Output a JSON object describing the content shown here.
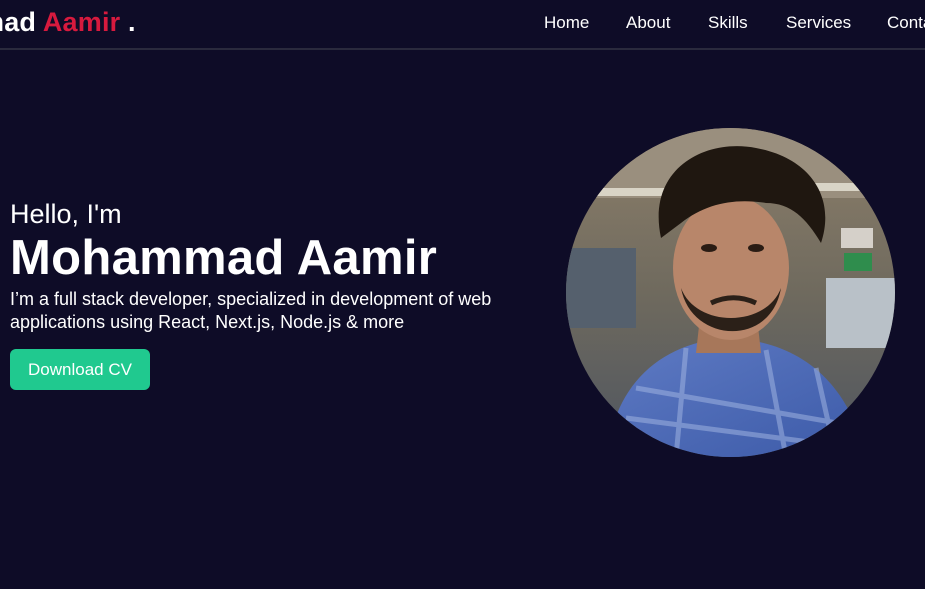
{
  "brand": {
    "name_prefix": "mad ",
    "name_accent": "Aamir",
    "name_suffix": " .",
    "accent_color": "#d71a3e"
  },
  "nav": {
    "items": [
      {
        "label": "Home"
      },
      {
        "label": "About"
      },
      {
        "label": "Skills"
      },
      {
        "label": "Services"
      },
      {
        "label": "Conta"
      }
    ]
  },
  "hero": {
    "greeting": "Hello, I'm",
    "name": "Mohammad Aamir",
    "bio": "I’m a full stack developer, specialized in development of web applications using React, Next.js, Node.js & more",
    "cta_label": "Download CV",
    "cta_color": "#20c98f"
  },
  "colors": {
    "background": "#0e0c27",
    "text": "#ffffff"
  },
  "icons": {
    "avatar": "profile-photo"
  }
}
